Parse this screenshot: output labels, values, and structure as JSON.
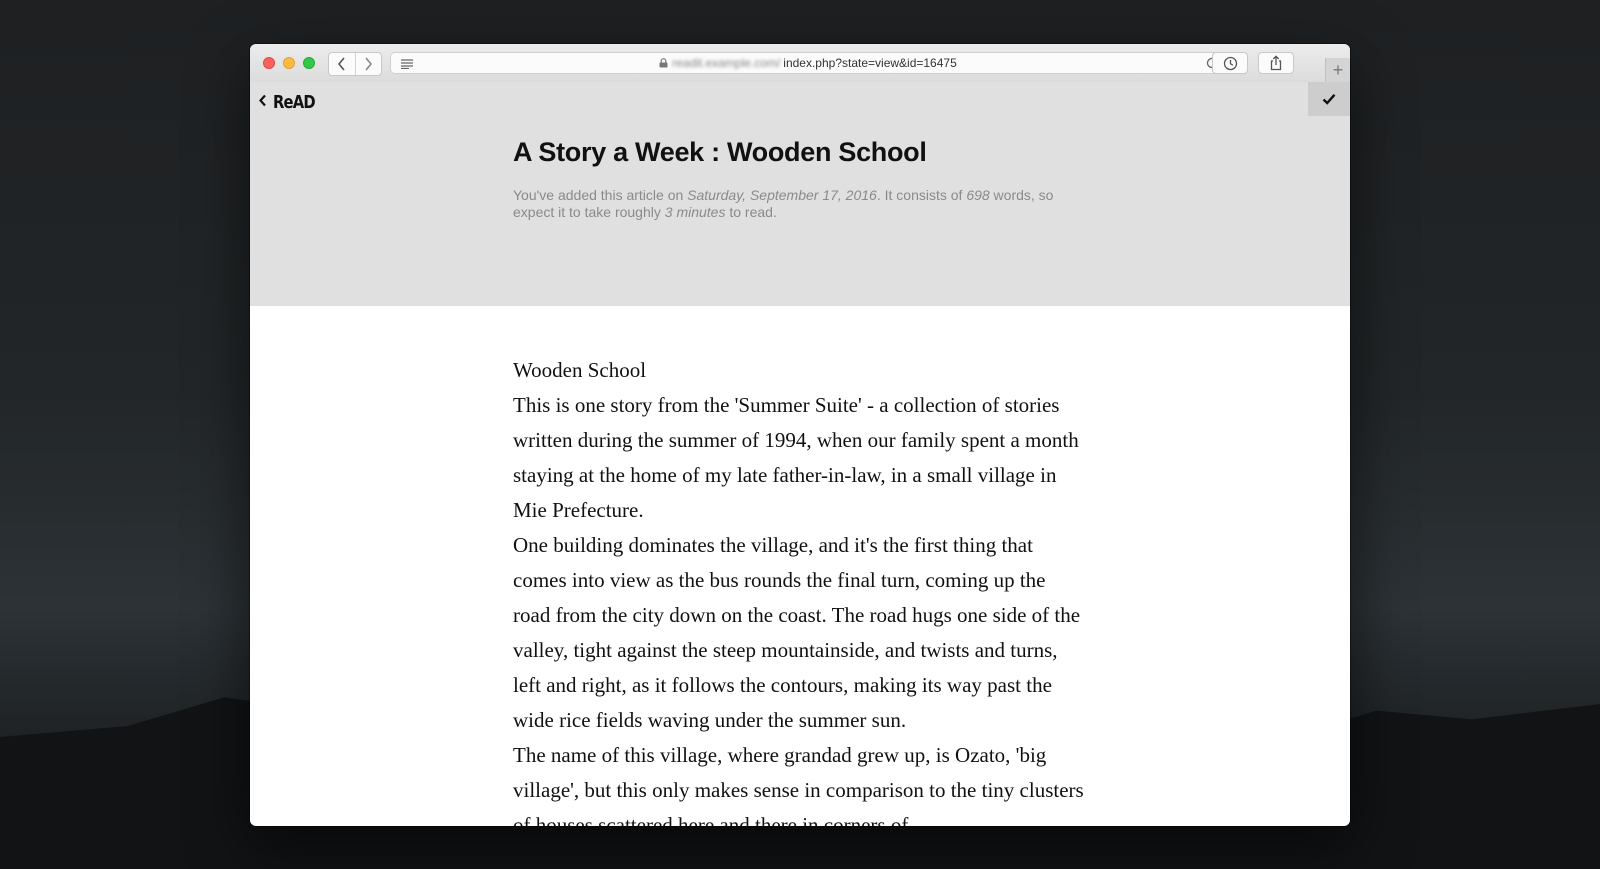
{
  "browser": {
    "url_obscured": "readit.example.com/",
    "url_path": "index.php?state=view&id=16475"
  },
  "app": {
    "logo": "ReAD"
  },
  "article": {
    "title": "A Story a Week : Wooden School",
    "meta": {
      "prefix": "You've added this article on ",
      "date": "Saturday, September 17, 2016",
      "mid": ". It consists of ",
      "words": "698",
      "mid2": " words, so expect it to take roughly ",
      "minutes": "3 minutes",
      "suffix": " to read."
    },
    "paragraphs": [
      "Wooden School",
      "This is one story from the 'Summer Suite' - a collection of stories written during the summer of 1994, when our family spent a month staying at the home of my late father-in-law, in a small village in Mie Prefecture.",
      "One building dominates the village, and it's the first thing that comes into view as the bus rounds the final turn, coming up the road from the city down on the coast. The road hugs one side of the valley, tight against the steep mountainside, and twists and turns, left and right, as it follows the contours, making its way past the wide rice fields waving under the summer sun.",
      "The name of this village, where grandad grew up, is Ozato, 'big village', but this only makes sense in comparison to the tiny clusters of houses scattered here and there in corners of"
    ]
  },
  "icons": {
    "back": "chevron-left-icon",
    "forward": "chevron-right-icon",
    "reader": "reader-view-icon",
    "lock": "lock-icon",
    "reload": "reload-icon",
    "history": "clock-icon",
    "share": "share-icon",
    "newtab": "plus-icon",
    "mark_read": "checkmark-icon"
  }
}
